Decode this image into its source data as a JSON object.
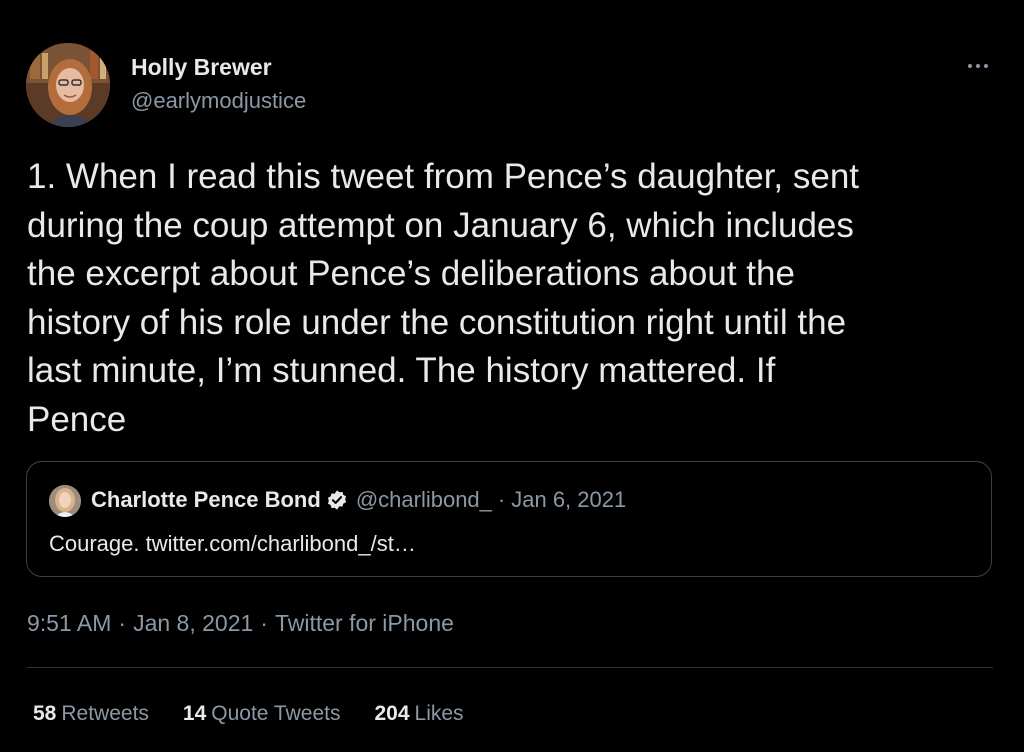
{
  "author": {
    "name": "Holly Brewer",
    "handle": "@earlymodjustice"
  },
  "tweet": {
    "text": "1. When I read this tweet from Pence’s daughter, sent\nduring the coup attempt on January 6, which includes\nthe excerpt about Pence’s deliberations about the\nhistory of his role under the constitution right until the\nlast minute, I’m stunned. The history mattered. If\nPence"
  },
  "quoted_tweet": {
    "name": "Charlotte Pence Bond",
    "handle": "@charlibond_",
    "separator": "·",
    "date": "Jan 6, 2021",
    "text": "Courage. twitter.com/charlibond_/st…"
  },
  "meta": {
    "time": "9:51 AM",
    "date": "Jan 8, 2021",
    "source": "Twitter for iPhone",
    "separator": "·"
  },
  "stats": {
    "retweets_count": "58",
    "retweets_label": "Retweets",
    "quote_tweets_count": "14",
    "quote_tweets_label": "Quote Tweets",
    "likes_count": "204",
    "likes_label": "Likes"
  },
  "icons": {
    "more": "more-horizontal-icon",
    "verified": "verified-badge-icon"
  },
  "colors": {
    "background": "#000000",
    "text_primary": "#e7e9ea",
    "text_secondary": "#8b98a5",
    "border": "#3e4144",
    "verified_badge": "#e7e9ea"
  }
}
